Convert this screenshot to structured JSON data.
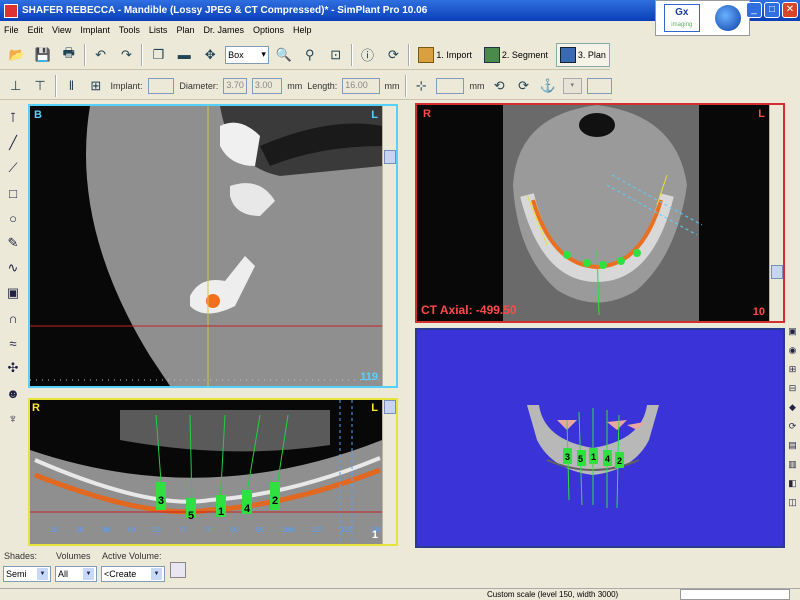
{
  "window": {
    "title": "SHAFER REBECCA - Mandible (Lossy JPEG & CT Compressed)* - SimPlant Pro  10.06",
    "logo_text": "Gx",
    "logo_subtext": "imaging"
  },
  "menu": [
    "File",
    "Edit",
    "View",
    "Implant",
    "Tools",
    "Lists",
    "Plan",
    "Dr. James",
    "Options",
    "Help"
  ],
  "toolbar": {
    "box_select": "Box",
    "workflow": [
      {
        "label": "1. Import",
        "active": false
      },
      {
        "label": "2. Segment",
        "active": false
      },
      {
        "label": "3. Plan",
        "active": true
      }
    ]
  },
  "implant_bar": {
    "implant_label": "Implant:",
    "implant_value": "",
    "diameter_label": "Diameter:",
    "diameter_value_1": "3.70",
    "diameter_value_2": "3.00",
    "diameter_unit": "mm",
    "length_label": "Length:",
    "length_value": "16.00",
    "length_unit": "mm",
    "extra_unit": "mm"
  },
  "views": {
    "cross_section": {
      "left": "B",
      "right": "L",
      "slice": "119"
    },
    "panoramic": {
      "left": "R",
      "right": "L",
      "slice": "1",
      "implant_labels": [
        "3",
        "5",
        "1",
        "4",
        "2"
      ],
      "scale": [
        "10",
        "20",
        "30",
        "40",
        "50",
        "60",
        "70",
        "80",
        "90",
        "100",
        "110",
        "120",
        "130"
      ]
    },
    "axial": {
      "left": "R",
      "right": "L",
      "label": "CT Axial: -499.50",
      "slice": "10"
    },
    "three_d": {
      "implant_labels": [
        "3",
        "5",
        "1",
        "4",
        "2"
      ]
    }
  },
  "bottom": {
    "shades_label": "Shades:",
    "shades_value": "Semi",
    "volumes_label": "Volumes",
    "volumes_value": "All",
    "active_volume_label": "Active Volume:",
    "active_volume_value": "<Create"
  },
  "status": {
    "text": "Custom scale (level 150, width 3000)"
  }
}
